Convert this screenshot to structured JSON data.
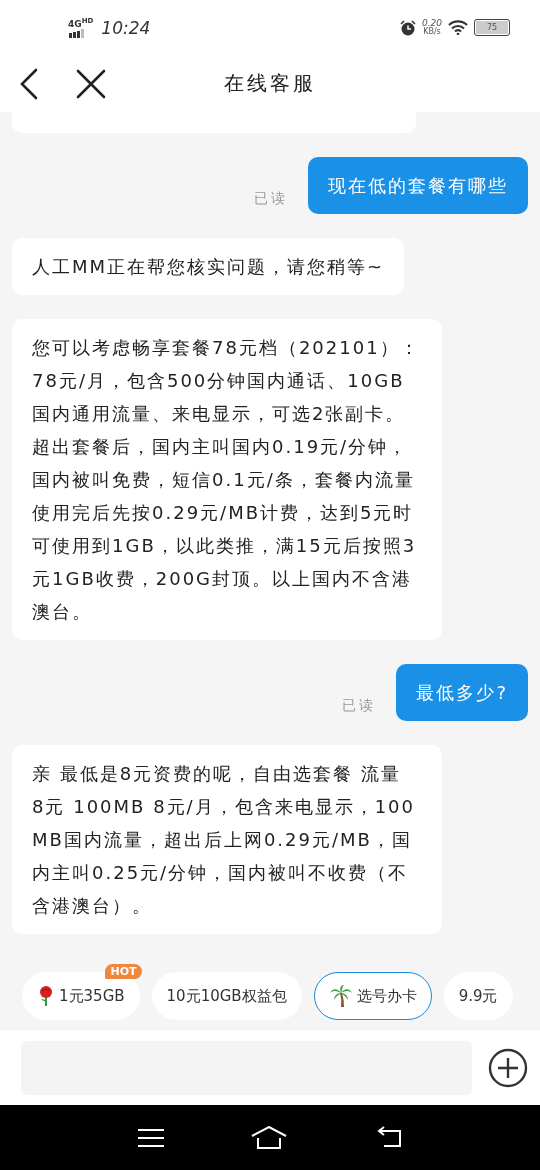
{
  "status_bar": {
    "network": "4G",
    "network_badge": "HD",
    "time": "10:24",
    "speed": "0.20",
    "speed_unit": "KB/s",
    "battery": "75"
  },
  "header": {
    "title": "在线客服"
  },
  "messages": [
    {
      "kind": "user",
      "text": "现在低的套餐有哪些",
      "receipt": "已读"
    },
    {
      "kind": "agent",
      "text": "人工MM正在帮您核实问题，请您稍等~"
    },
    {
      "kind": "agent",
      "text": "您可以考虑畅享套餐78元档（202101）：78元/月，包含500分钟国内通话、10GB国内通用流量、来电显示，可选2张副卡。超出套餐后，国内主叫国内0.19元/分钟，国内被叫免费，短信0.1元/条，套餐内流量使用完后先按0.29元/MB计费，达到5元时可使用到1GB，以此类推，满15元后按照3元1GB收费，200G封顶。以上国内不含港澳台。"
    },
    {
      "kind": "user",
      "text": "最低多少?",
      "receipt": "已读"
    },
    {
      "kind": "agent",
      "text": "亲  最低是8元资费的呢，自由选套餐 流量 8元 100MB    8元/月，包含来电显示，100MB国内流量，超出后上网0.29元/MB，国内主叫0.25元/分钟，国内被叫不收费（不含港澳台）。"
    }
  ],
  "quick_replies": [
    {
      "kind": "rose",
      "label": "1元35GB",
      "badge": "HOT",
      "selected": false
    },
    {
      "kind": "plain",
      "label": "10元10GB权益包",
      "selected": false
    },
    {
      "kind": "palm",
      "label": "选号办卡",
      "selected": true
    },
    {
      "kind": "plain",
      "label": "9.9元",
      "selected": false
    }
  ]
}
